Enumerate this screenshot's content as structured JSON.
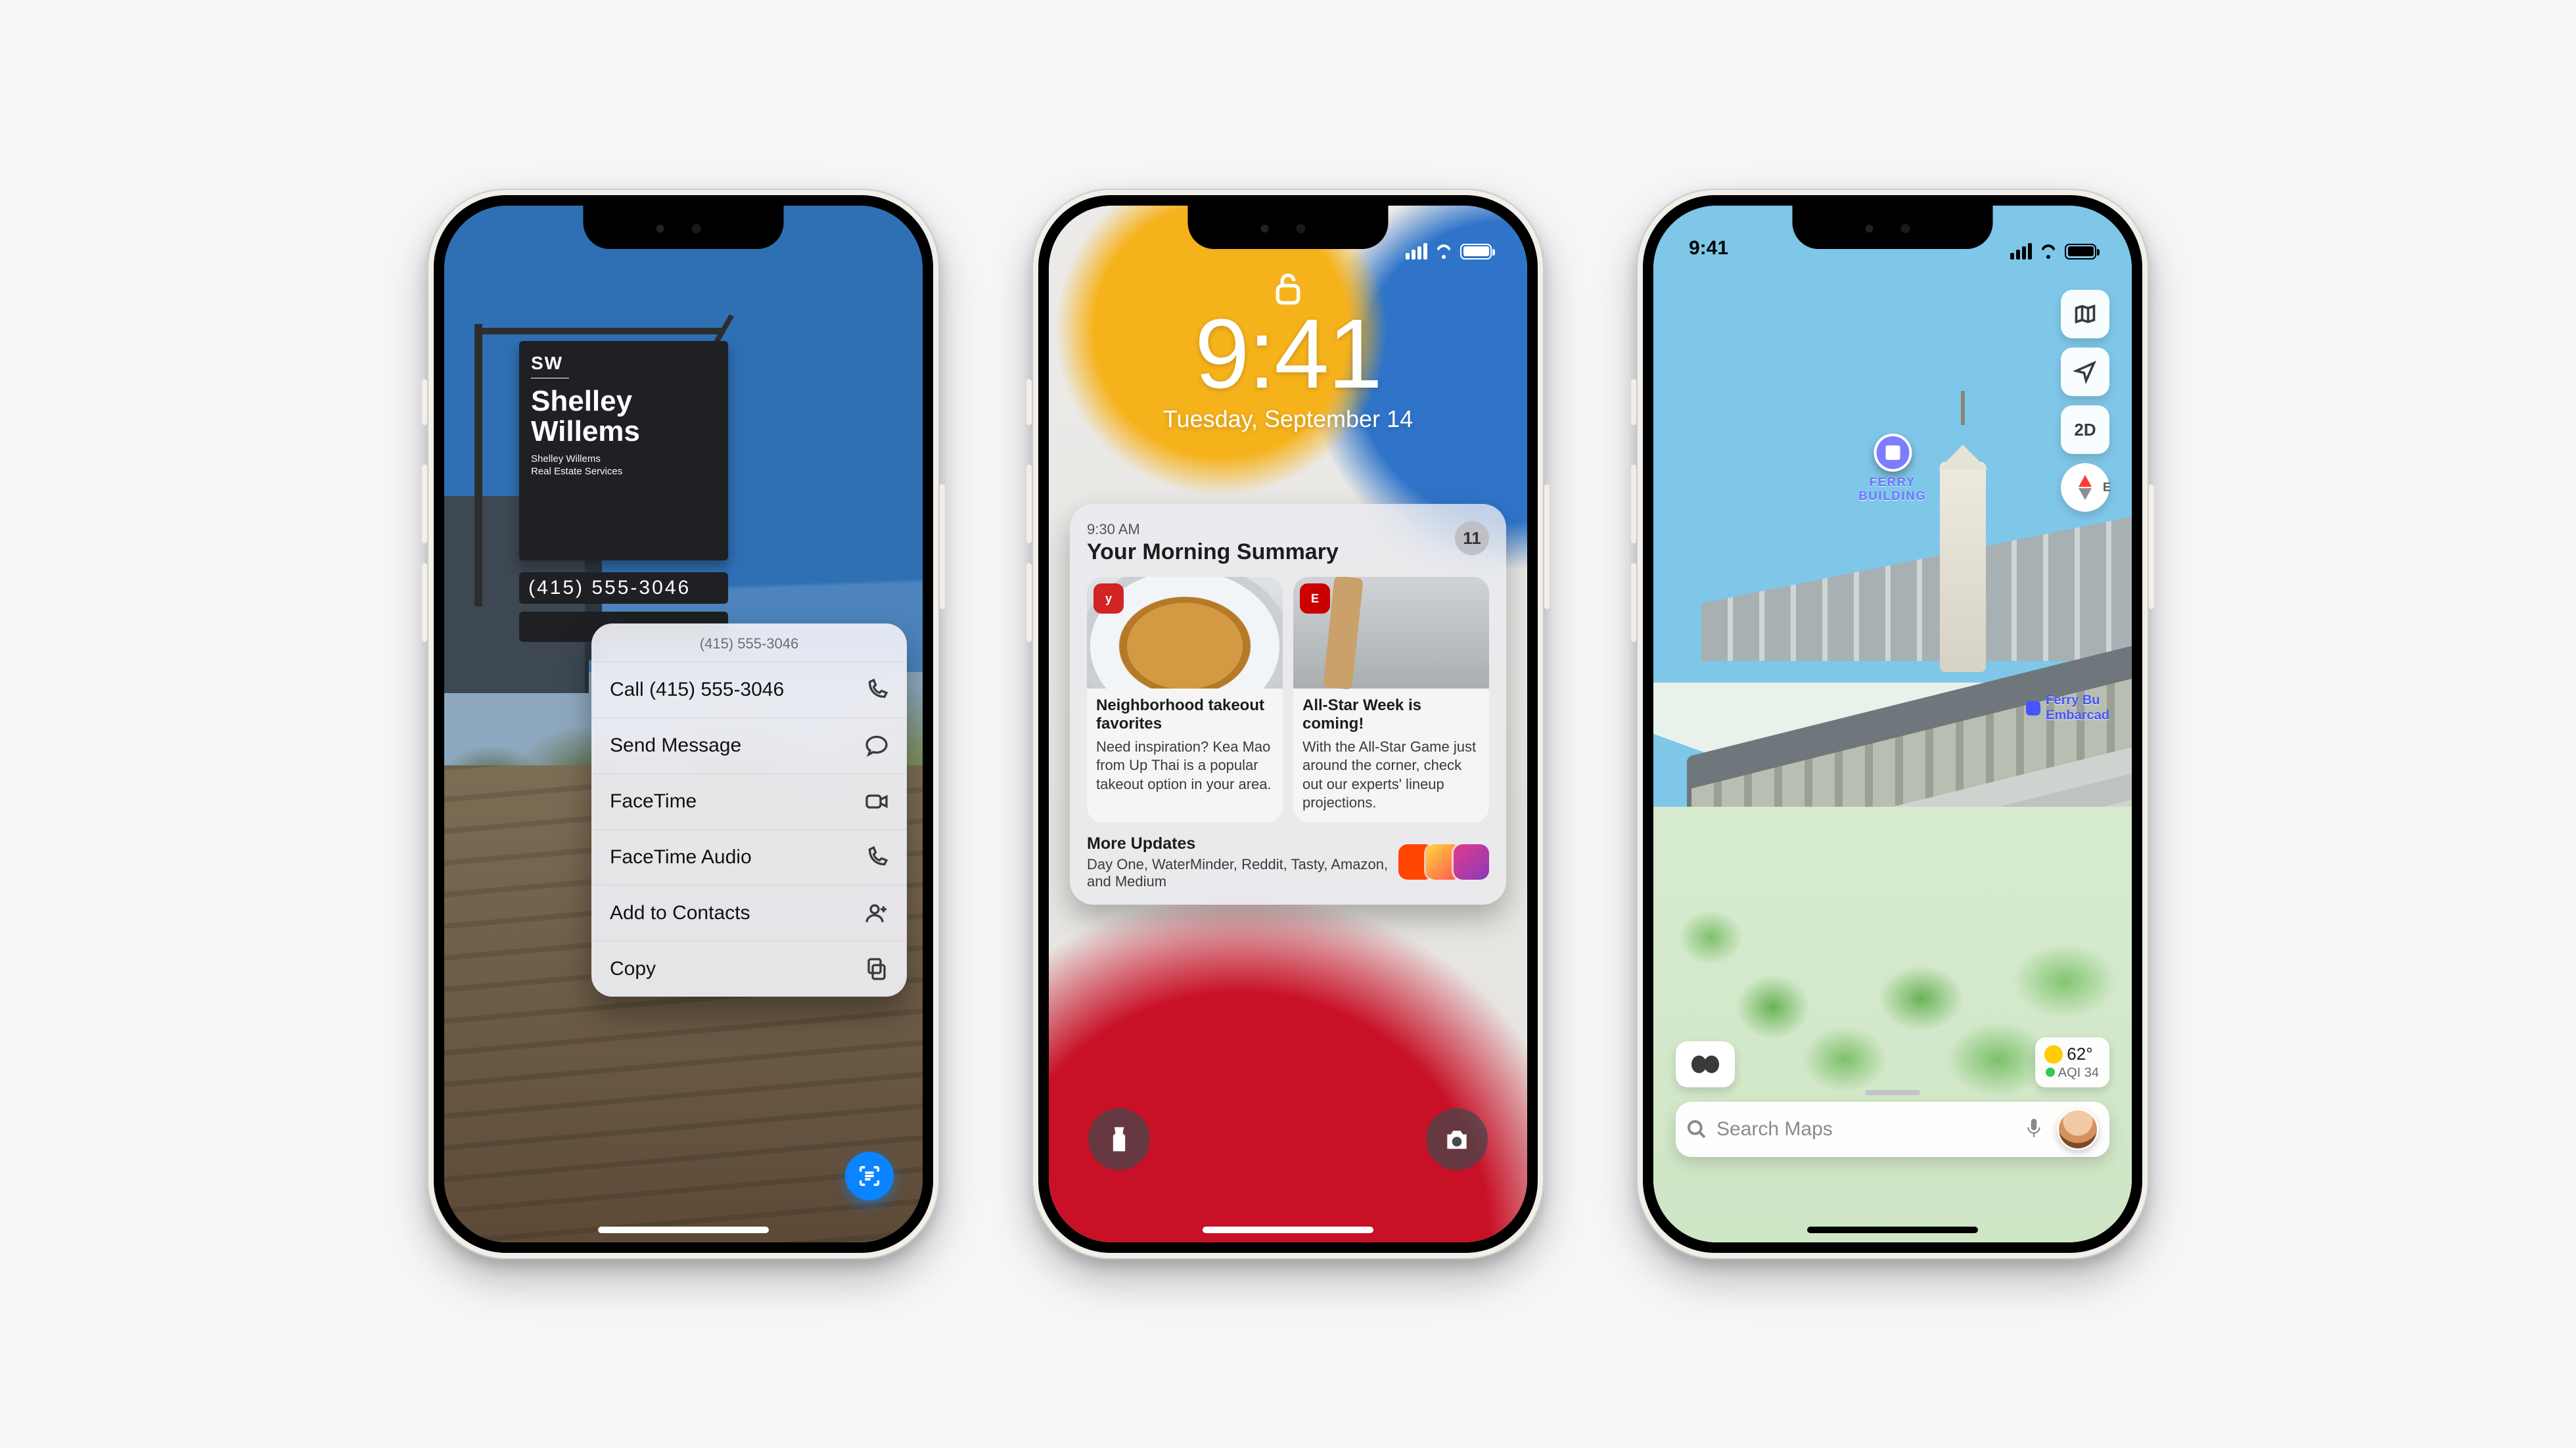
{
  "status": {
    "time": "9:41"
  },
  "phone1": {
    "sign": {
      "logo": "SW",
      "name_line1": "Shelley",
      "name_line2": "Willems",
      "sub_line1": "Shelley Willems",
      "sub_line2": "Real Estate Services",
      "phone_display": "(415) 555-3046"
    },
    "menu": {
      "header": "(415) 555-3046",
      "items": [
        {
          "label": "Call (415) 555-3046",
          "icon": "phone"
        },
        {
          "label": "Send Message",
          "icon": "message"
        },
        {
          "label": "FaceTime",
          "icon": "video"
        },
        {
          "label": "FaceTime Audio",
          "icon": "phone"
        },
        {
          "label": "Add to Contacts",
          "icon": "add-contact"
        },
        {
          "label": "Copy",
          "icon": "copy"
        }
      ]
    }
  },
  "phone2": {
    "clock": {
      "time": "9:41",
      "date": "Tuesday, September 14"
    },
    "summary": {
      "timestamp": "9:30 AM",
      "title": "Your Morning Summary",
      "count": "11",
      "cards": [
        {
          "source": "yelp",
          "headline": "Neighborhood takeout favorites",
          "body": "Need inspiration? Kea Mao from Up Thai is a popular takeout option in your area."
        },
        {
          "source": "espn",
          "headline": "All-Star Week is coming!",
          "body": "With the All-Star Game just around the corner, check out our experts' lineup projections."
        }
      ],
      "more": {
        "title": "More Updates",
        "body": "Day One, WaterMinder, Reddit, Tasty, Amazon, and Medium"
      }
    }
  },
  "phone3": {
    "poi": {
      "name": "FERRY",
      "name2": "BUILDING"
    },
    "transit": {
      "line1": "Ferry Bu",
      "line2": "Embarcad"
    },
    "controls": {
      "mode_label": "2D",
      "compass_dir": "E"
    },
    "weather": {
      "temp": "62°",
      "aqi_label": "AQI 34"
    },
    "search": {
      "placeholder": "Search Maps"
    }
  }
}
